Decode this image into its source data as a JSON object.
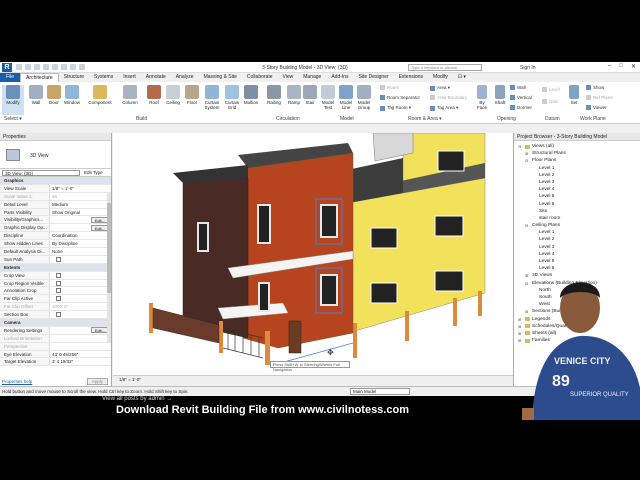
{
  "window": {
    "app_icon": "R",
    "title": "3-Story Building Model - 3D View: {3D}",
    "search_placeholder": "Type a keyword or phrase",
    "sign_in": "Sign In",
    "controls": [
      "–",
      "□",
      "✕"
    ]
  },
  "ribbon_tabs": [
    {
      "label": "File"
    },
    {
      "label": "Architecture"
    },
    {
      "label": "Structure"
    },
    {
      "label": "Systems"
    },
    {
      "label": "Insert"
    },
    {
      "label": "Annotate"
    },
    {
      "label": "Analyze"
    },
    {
      "label": "Massing & Site"
    },
    {
      "label": "Collaborate"
    },
    {
      "label": "View"
    },
    {
      "label": "Manage"
    },
    {
      "label": "Add-Ins"
    },
    {
      "label": "Site Designer"
    },
    {
      "label": "Extensions"
    },
    {
      "label": "Modify"
    },
    {
      "label": "⊡ ▾"
    }
  ],
  "ribbon": {
    "select": {
      "modify": "Modify",
      "label": "Select ▾"
    },
    "build": [
      "Wall",
      "Door",
      "Window",
      "Component",
      "Column",
      "Roof",
      "Ceiling",
      "Floor",
      "Curtain System",
      "Curtain Grid",
      "Mullion"
    ],
    "build_label": "Build",
    "circulation": [
      "Railing",
      "Ramp",
      "Stair"
    ],
    "circulation_label": "Circulation",
    "model": [
      "Model Text",
      "Model Line",
      "Model Group"
    ],
    "model_label": "Model",
    "room_area": [
      "Room",
      "Room Separator",
      "Tag Room ▾",
      "Area ▾",
      "Area Boundary",
      "Tag Area ▾"
    ],
    "room_area_label": "Room & Area ▾",
    "opening": [
      "By Face",
      "Shaft",
      "Wall",
      "Vertical",
      "Dormer"
    ],
    "opening_label": "Opening",
    "datum": [
      "Level",
      "Grid"
    ],
    "datum_label": "Datum",
    "work_plane": [
      "Set",
      "Show",
      "Ref Plane",
      "Viewer"
    ],
    "work_plane_label": "Work Plane"
  },
  "properties": {
    "title": "Properties",
    "type_name": "3D View",
    "filter": "3D View: {3D}",
    "edit_type": "Edit Type",
    "rows": [
      {
        "k": "Graphics",
        "section": true
      },
      {
        "k": "View Scale",
        "v": "1/8\" = 1'-0\""
      },
      {
        "k": "Scale Value 1:",
        "v": "96",
        "disabled": true
      },
      {
        "k": "Detail Level",
        "v": "Medium"
      },
      {
        "k": "Parts Visibility",
        "v": "Show Original"
      },
      {
        "k": "Visibility/Graphics...",
        "v": "",
        "btn": "Edit..."
      },
      {
        "k": "Graphic Display Op...",
        "v": "",
        "btn": "Edit..."
      },
      {
        "k": "Discipline",
        "v": "Coordination"
      },
      {
        "k": "Show Hidden Lines",
        "v": "By Discipline"
      },
      {
        "k": "Default Analysis Di...",
        "v": "None"
      },
      {
        "k": "Sun Path",
        "v": "",
        "cb": true
      },
      {
        "k": "Extents",
        "section": true
      },
      {
        "k": "Crop View",
        "v": "",
        "cb": true
      },
      {
        "k": "Crop Region Visible",
        "v": "",
        "cb": true
      },
      {
        "k": "Annotation Crop",
        "v": "",
        "cb": true
      },
      {
        "k": "Far Clip Active",
        "v": "",
        "cb": true
      },
      {
        "k": "Far Clip Offset",
        "v": "1000' 0\"",
        "disabled": true
      },
      {
        "k": "Section Box",
        "v": "",
        "cb": true
      },
      {
        "k": "Camera",
        "section": true
      },
      {
        "k": "Rendering Settings",
        "v": "",
        "btn": "Edit..."
      },
      {
        "k": "Locked Orientation",
        "v": "",
        "disabled": true
      },
      {
        "k": "Perspective",
        "v": "",
        "disabled": true
      },
      {
        "k": "Eye Elevation",
        "v": "43' 0 45/256\""
      },
      {
        "k": "Target Elevation",
        "v": "3' 4 19/32\""
      }
    ],
    "help": "Properties help",
    "apply": "Apply"
  },
  "view_control_bar": "1/8\" = 1'-0\"",
  "tooltip": "Press Shift+W to SteeringWheels Full Navigation",
  "project_browser": {
    "title": "Project Browser - 3-Story Building Model",
    "tree": [
      {
        "label": "Views (all)",
        "level": 0,
        "toggle": "⊟"
      },
      {
        "label": "Structural Plans",
        "level": 1,
        "toggle": "⊞"
      },
      {
        "label": "Floor Plans",
        "level": 1,
        "toggle": "⊟"
      },
      {
        "label": "Level 1",
        "level": 2
      },
      {
        "label": "Level 2",
        "level": 2
      },
      {
        "label": "Level 3",
        "level": 2
      },
      {
        "label": "Level 4",
        "level": 2
      },
      {
        "label": "Level 5",
        "level": 2
      },
      {
        "label": "Level 6",
        "level": 2
      },
      {
        "label": "Site",
        "level": 2
      },
      {
        "label": "stair room",
        "level": 2
      },
      {
        "label": "Ceiling Plans",
        "level": 1,
        "toggle": "⊟"
      },
      {
        "label": "Level 1",
        "level": 2
      },
      {
        "label": "Level 2",
        "level": 2
      },
      {
        "label": "Level 3",
        "level": 2
      },
      {
        "label": "Level 4",
        "level": 2
      },
      {
        "label": "Level 5",
        "level": 2
      },
      {
        "label": "Level 6",
        "level": 2
      },
      {
        "label": "3D Views",
        "level": 1,
        "toggle": "⊞"
      },
      {
        "label": "Elevations (Building Elevation)",
        "level": 1,
        "toggle": "⊟"
      },
      {
        "label": "North",
        "level": 2
      },
      {
        "label": "South",
        "level": 2
      },
      {
        "label": "West",
        "level": 2
      },
      {
        "label": "Sections (Building Section)",
        "level": 1,
        "toggle": "⊞"
      },
      {
        "label": "Legends",
        "level": 0,
        "toggle": "⊞"
      },
      {
        "label": "Schedules/Quantities (all)",
        "level": 0,
        "toggle": "⊞"
      },
      {
        "label": "Sheets (all)",
        "level": 0,
        "toggle": "⊞"
      },
      {
        "label": "Families",
        "level": 0,
        "toggle": "⊞"
      }
    ]
  },
  "status_bar": {
    "hint": "Hold button and move mouse to Scroll the view. Hold Ctrl key to Zoom. Hold Shift key to Spin.",
    "model": "Main Model"
  },
  "overlay": {
    "caption": "Download Revit Building File from www.civilnotess.com",
    "view_all": "View all posts by admin →",
    "shirt_text": [
      "VENICE CITY",
      "89",
      "SUPERIOR QUALITY"
    ]
  },
  "colors": {
    "accent": "#1a5ea8",
    "yellow_wall": "#f2e15a",
    "brick": "#b5441f",
    "dark_brick": "#4a2a24"
  }
}
